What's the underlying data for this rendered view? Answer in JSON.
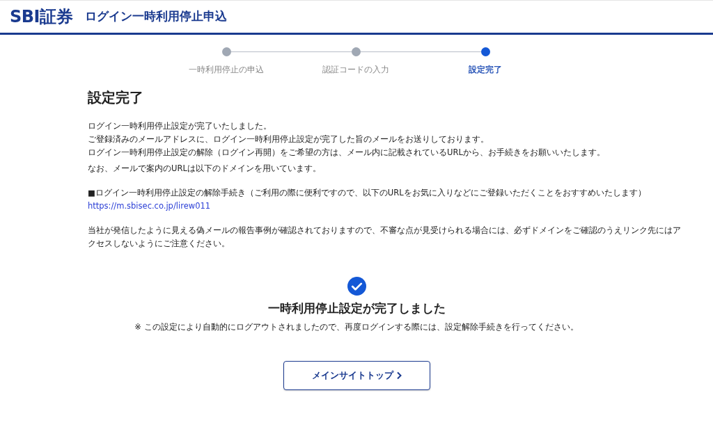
{
  "header": {
    "logo": "SBI証券",
    "title": "ログイン一時利用停止申込"
  },
  "steps": [
    {
      "label": "一時利用停止の申込",
      "selected": false
    },
    {
      "label": "認証コードの入力",
      "selected": false
    },
    {
      "label": "設定完了",
      "selected": true
    }
  ],
  "heading": "設定完了",
  "paragraphs": [
    "ログイン一時利用停止設定が完了いたしました。",
    "ご登録済みのメールアドレスに、ログイン一時利用停止設定が完了した旨のメールをお送りしております。",
    "ログイン一時利用停止設定の解除（ログイン再開）をご希望の方は、メール内に記載されているURLから、お手続きをお願いいたします。"
  ],
  "domain_note": "なお、メールで案内のURLは以下のドメインを用いています。",
  "release_note": "■ログイン一時利用停止設定の解除手続き（ご利用の際に便利ですので、以下のURLをお気に入りなどにご登録いただくことをおすすめいたします）",
  "release_link": "https://m.sbisec.co.jp/lirew011",
  "warning": "当社が発信したように見える偽メールの報告事例が確認されておりますので、不審な点が見受けられる場合には、必ずドメインをご確認のうえリンク先にはアクセスしないようにご注意ください。",
  "complete": {
    "title": "一時利用停止設定が完了しました",
    "note": "※ この設定により自動的にログアウトされましたので、再度ログインする際には、設定解除手続きを行ってください。"
  },
  "button": "メインサイトトップ"
}
